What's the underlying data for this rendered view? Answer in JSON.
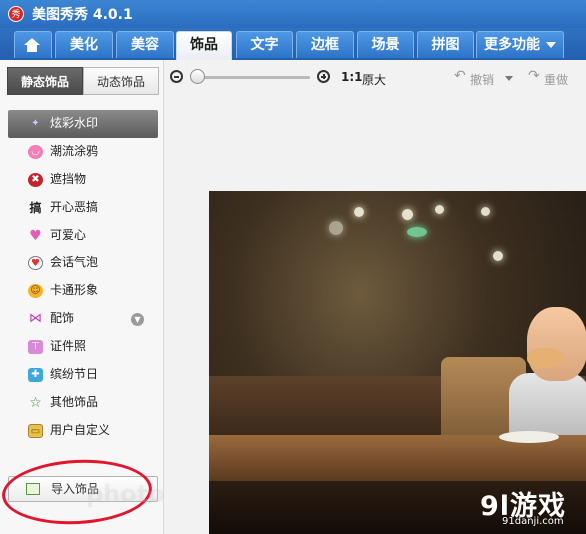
{
  "window": {
    "title": "美图秀秀 4.0.1",
    "logo_char": "秀"
  },
  "tabs": [
    {
      "label": "",
      "icon": "home-icon"
    },
    {
      "label": "美化"
    },
    {
      "label": "美容"
    },
    {
      "label": "饰品",
      "active": true
    },
    {
      "label": "文字"
    },
    {
      "label": "边框"
    },
    {
      "label": "场景"
    },
    {
      "label": "拼图"
    },
    {
      "label": "更多功能",
      "has_dropdown": true
    }
  ],
  "sidebar": {
    "subtabs": [
      {
        "label": "静态饰品",
        "active": true
      },
      {
        "label": "动态饰品"
      }
    ],
    "items": [
      {
        "label": "炫彩水印",
        "icon": "sparkle-icon",
        "active": true
      },
      {
        "label": "潮流涂鸦",
        "icon": "lips-icon"
      },
      {
        "label": "遮挡物",
        "icon": "block-icon"
      },
      {
        "label": "开心恶搞",
        "icon": "funny-icon"
      },
      {
        "label": "可爱心",
        "icon": "heart-icon"
      },
      {
        "label": "会话气泡",
        "icon": "speech-bubble-icon"
      },
      {
        "label": "卡通形象",
        "icon": "cartoon-icon"
      },
      {
        "label": "配饰",
        "icon": "bow-icon",
        "expand_icon": "chevron-down-icon"
      },
      {
        "label": "证件照",
        "icon": "shirt-icon"
      },
      {
        "label": "缤纷节日",
        "icon": "gift-icon"
      },
      {
        "label": "其他饰品",
        "icon": "star-icon"
      },
      {
        "label": "用户自定义",
        "icon": "folder-icon"
      }
    ],
    "import_button": "导入饰品"
  },
  "toolbar": {
    "zoom_level": 0.05,
    "one_to_one": "1:1",
    "original_label": "原大",
    "undo_label": "撤销",
    "redo_label": "重做"
  },
  "watermark": {
    "main": "9l游戏",
    "sub": "91danji.com",
    "faint": "photo"
  },
  "colors": {
    "accent": "#2b6bb8",
    "annotation_circle": "#e3142c"
  }
}
